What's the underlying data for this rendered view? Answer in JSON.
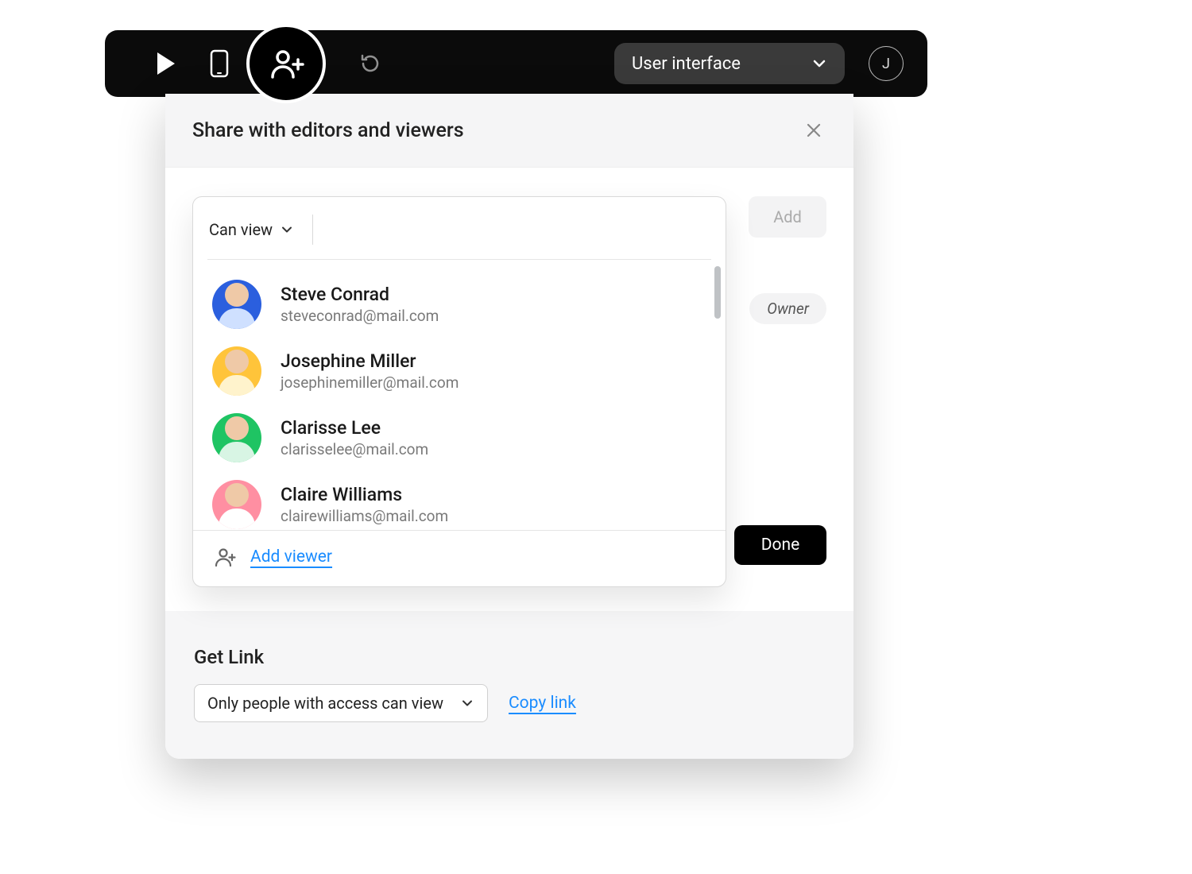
{
  "topbar": {
    "dropdown_label": "User interface",
    "avatar_initial": "J"
  },
  "share_dialog": {
    "title": "Share with editors and viewers",
    "permission_label": "Can view",
    "add_button": "Add",
    "owner_chip": "Owner",
    "done_button": "Done",
    "add_viewer_link": "Add viewer",
    "suggestions": [
      {
        "name": "Steve Conrad",
        "email": "steveconrad@mail.com",
        "avatar_bg": "#2b5fde"
      },
      {
        "name": "Josephine Miller",
        "email": "josephinemiller@mail.com",
        "avatar_bg": "#ffc43a"
      },
      {
        "name": "Clarisse Lee",
        "email": "clarisselee@mail.com",
        "avatar_bg": "#1fc463"
      },
      {
        "name": "Claire Williams",
        "email": "clairewilliams@mail.com",
        "avatar_bg": "#ff8fa2"
      }
    ]
  },
  "get_link": {
    "title": "Get Link",
    "access_label": "Only people with access can view",
    "copy_link": "Copy link"
  }
}
